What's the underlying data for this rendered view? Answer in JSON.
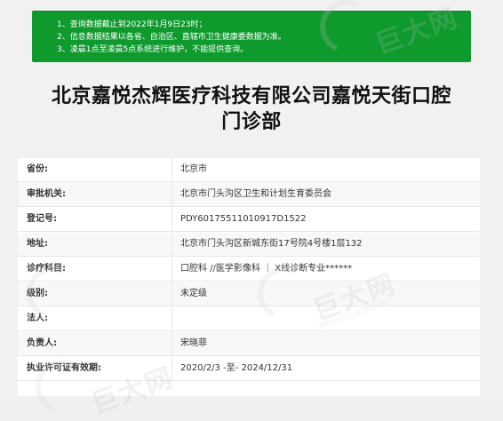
{
  "notice": {
    "lines": [
      "1、查询数据截止到2022年1月9日23时；",
      "2、信息数据结果以各省、自治区、直辖市卫生健康委数据为准。",
      "3、凌晨1点至凌晨5点系统进行维护，不能提供查询。"
    ]
  },
  "title": {
    "line1": "北京嘉悦杰辉医疗科技有限公司嘉悦天街口腔",
    "line2": "门诊部"
  },
  "rows": [
    {
      "label": "省份:",
      "value": "北京市"
    },
    {
      "label": "审批机关:",
      "value": "北京市门头沟区卫生和计划生育委员会"
    },
    {
      "label": "登记号:",
      "value": "PDY60175511010917D1522"
    },
    {
      "label": "地址:",
      "value": "北京市门头沟区新城东街17号院4号楼1层132"
    },
    {
      "label": "诊疗科目:",
      "value": "口腔科 //医学影像科 ｜ X线诊断专业******"
    },
    {
      "label": "级别:",
      "value": "未定级"
    },
    {
      "label": "法人:",
      "value": ""
    },
    {
      "label": "负责人:",
      "value": "宋晓菲"
    },
    {
      "label": "执业许可证有效期:",
      "value": "2020/2/3 -至- 2024/12/31"
    }
  ],
  "watermark": {
    "brand": "巨大网",
    "url": "www.cnjuda.com"
  },
  "colors": {
    "notice_bg": "#0f9a2e",
    "page_bg": "#f1f1f1"
  }
}
